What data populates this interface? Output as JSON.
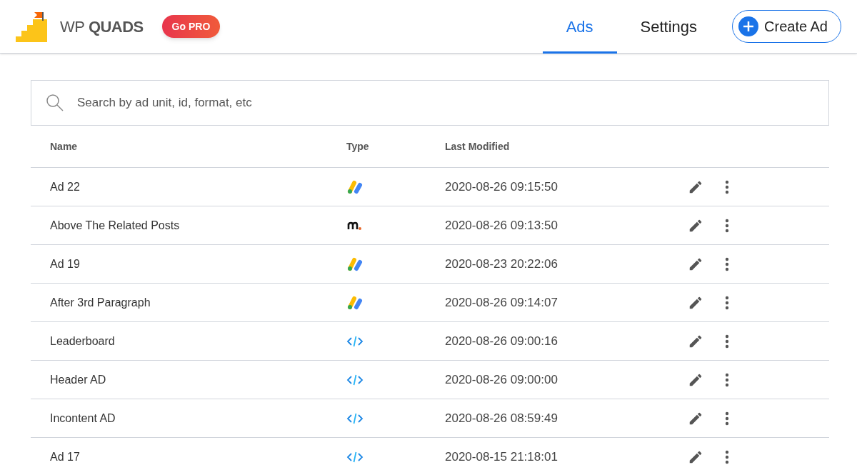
{
  "brand": {
    "light": "WP",
    "bold": "QUADS"
  },
  "pro_button": "Go PRO",
  "tabs": [
    {
      "label": "Ads",
      "selected": true
    },
    {
      "label": "Settings",
      "selected": false
    }
  ],
  "create_button": "Create Ad",
  "search": {
    "placeholder": "Search by ad unit, id, format, etc"
  },
  "table": {
    "columns": [
      "Name",
      "Type",
      "Last Modified"
    ],
    "rows": [
      {
        "name": "Ad 22",
        "kind": "adsense",
        "modified": "2020-08-26 09:15:50"
      },
      {
        "name": "Above The Related Posts",
        "kind": "medianet",
        "modified": "2020-08-26 09:13:50"
      },
      {
        "name": "Ad 19",
        "kind": "adsense",
        "modified": "2020-08-23 20:22:06"
      },
      {
        "name": "After 3rd Paragraph",
        "kind": "adsense",
        "modified": "2020-08-26 09:14:07"
      },
      {
        "name": "Leaderboard",
        "kind": "code",
        "modified": "2020-08-26 09:00:16"
      },
      {
        "name": "Header AD",
        "kind": "code",
        "modified": "2020-08-26 09:00:00"
      },
      {
        "name": "Incontent AD",
        "kind": "code",
        "modified": "2020-08-26 08:59:49"
      },
      {
        "name": "Ad 17",
        "kind": "code",
        "modified": "2020-08-15 21:18:01"
      }
    ]
  }
}
